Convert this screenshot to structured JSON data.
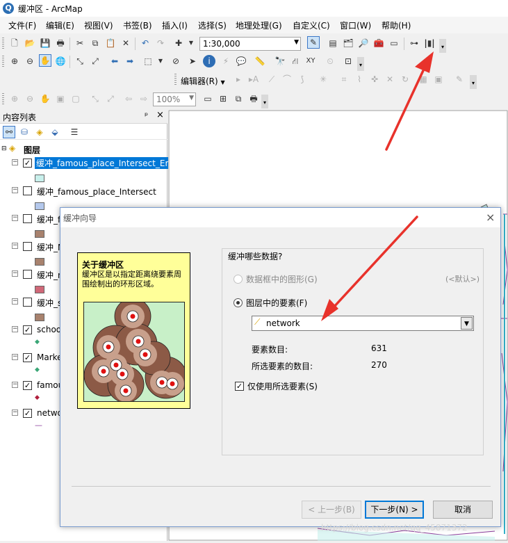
{
  "window": {
    "title": "缓冲区 - ArcMap",
    "logo": "Q"
  },
  "menu": [
    "文件(F)",
    "编辑(E)",
    "视图(V)",
    "书签(B)",
    "插入(I)",
    "选择(S)",
    "地理处理(G)",
    "自定义(C)",
    "窗口(W)",
    "帮助(H)"
  ],
  "toolbar": {
    "scale_value": "1:30,000",
    "editor_label": "编辑器(R)",
    "zoom_value": "100%"
  },
  "toc": {
    "title": "内容列表",
    "pin": "ᵖ",
    "close": "×",
    "root_label": "图层",
    "layers": [
      {
        "name": "缓冲_famous_place_Intersect_Er",
        "checked": true,
        "swatch": "#c8f0ec",
        "selected": true
      },
      {
        "name": "缓冲_famous_place_Intersect",
        "checked": false,
        "swatch": "#b4c8ec"
      },
      {
        "name": "缓冲_f",
        "checked": false,
        "swatch": "#a8826e"
      },
      {
        "name": "缓冲_M",
        "checked": false,
        "swatch": "#a8826e"
      },
      {
        "name": "缓冲_n",
        "checked": false,
        "swatch": "#d06878"
      },
      {
        "name": "缓冲_s",
        "checked": false,
        "swatch": "#a8826e"
      },
      {
        "name": "schoo",
        "checked": true,
        "symbol": "◆",
        "symbol_color": "#3aa676"
      },
      {
        "name": "Marke",
        "checked": true,
        "symbol": "◆",
        "symbol_color": "#3aa676"
      },
      {
        "name": "famou",
        "checked": true,
        "symbol": "◆",
        "symbol_color": "#b01e3c"
      },
      {
        "name": "netwo",
        "checked": true,
        "symbol": "—",
        "symbol_color": "#8a3a9a"
      }
    ]
  },
  "dialog": {
    "title": "缓冲向导",
    "close_icon": "×",
    "info_heading": "关于缓冲区",
    "info_text": "缓冲区是以指定距离绕要素周围绘制出的环形区域。",
    "question": "缓冲哪些数据?",
    "option_graphics": "数据框中的图形(G)",
    "default_hint": "(<默认>)",
    "option_layer": "图层中的要素(F)",
    "layer_select_value": "network",
    "feature_count_label": "要素数目:",
    "feature_count_value": "631",
    "selected_count_label": "所选要素的数目:",
    "selected_count_value": "270",
    "use_selected_label": "仅使用所选要素(S)",
    "use_selected_checked": true,
    "back_button": "< 上一步(B)",
    "next_button": "下一步(N) >",
    "cancel_button": "取消"
  },
  "watermark": "https://blog.csdn.net/qq_45871372",
  "colors": {
    "arrow": "#e8322b",
    "selection": "#0078d7",
    "info_bg": "#ffff99",
    "buffer_ring": "#8c5a46"
  }
}
